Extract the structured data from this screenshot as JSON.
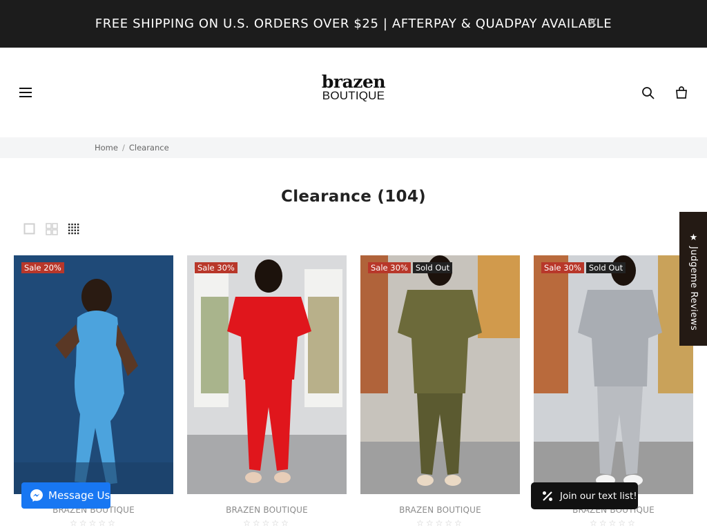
{
  "announcement": {
    "text": "FREE SHIPPING ON U.S. ORDERS OVER $25 | AFTERPAY & QUADPAY AVAILABLE",
    "close_icon": "close-icon"
  },
  "header": {
    "logo_top": "brazen",
    "logo_bottom": "BOUTIQUE",
    "icons": [
      "menu-icon",
      "search-icon",
      "cart-icon"
    ]
  },
  "breadcrumb": {
    "home": "Home",
    "separator": "/",
    "current": "Clearance"
  },
  "collection": {
    "title": "Clearance (104)"
  },
  "grid_toggles": [
    "grid-1-icon",
    "grid-2-icon",
    "grid-4-icon"
  ],
  "products": [
    {
      "badges": [
        {
          "label": "Sale 20%",
          "type": "sale"
        }
      ],
      "vendor": "BRAZEN BOUTIQUE",
      "stars": "☆☆☆☆☆",
      "image_colors": {
        "bg": "#1f4a78",
        "garment": "#4ca3dd"
      }
    },
    {
      "badges": [
        {
          "label": "Sale 30%",
          "type": "sale"
        }
      ],
      "vendor": "BRAZEN BOUTIQUE",
      "stars": "☆☆☆☆☆",
      "image_colors": {
        "bg": "#d9dadc",
        "garment": "#e0161c"
      }
    },
    {
      "badges": [
        {
          "label": "Sale 30%",
          "type": "sale"
        },
        {
          "label": "Sold Out",
          "type": "sold"
        }
      ],
      "vendor": "BRAZEN BOUTIQUE",
      "stars": "☆☆☆☆☆",
      "image_colors": {
        "bg": "#c7c3bc",
        "garment": "#6c6a3a"
      }
    },
    {
      "badges": [
        {
          "label": "Sale 30%",
          "type": "sale"
        },
        {
          "label": "Sold Out",
          "type": "sold"
        }
      ],
      "vendor": "BRAZEN BOUTIQUE",
      "stars": "☆☆☆☆☆",
      "image_colors": {
        "bg": "#cfd2d6",
        "garment": "#a9adb3"
      }
    }
  ],
  "widgets": {
    "judgeme": "★ Judgeme Reviews",
    "messenger": "Message Us",
    "textlist": "Join our text list!"
  },
  "colors": {
    "announcement_bg": "#1c1c1c",
    "sale_badge": "#b8372a",
    "sold_badge": "#222222",
    "messenger": "#1877f2"
  }
}
